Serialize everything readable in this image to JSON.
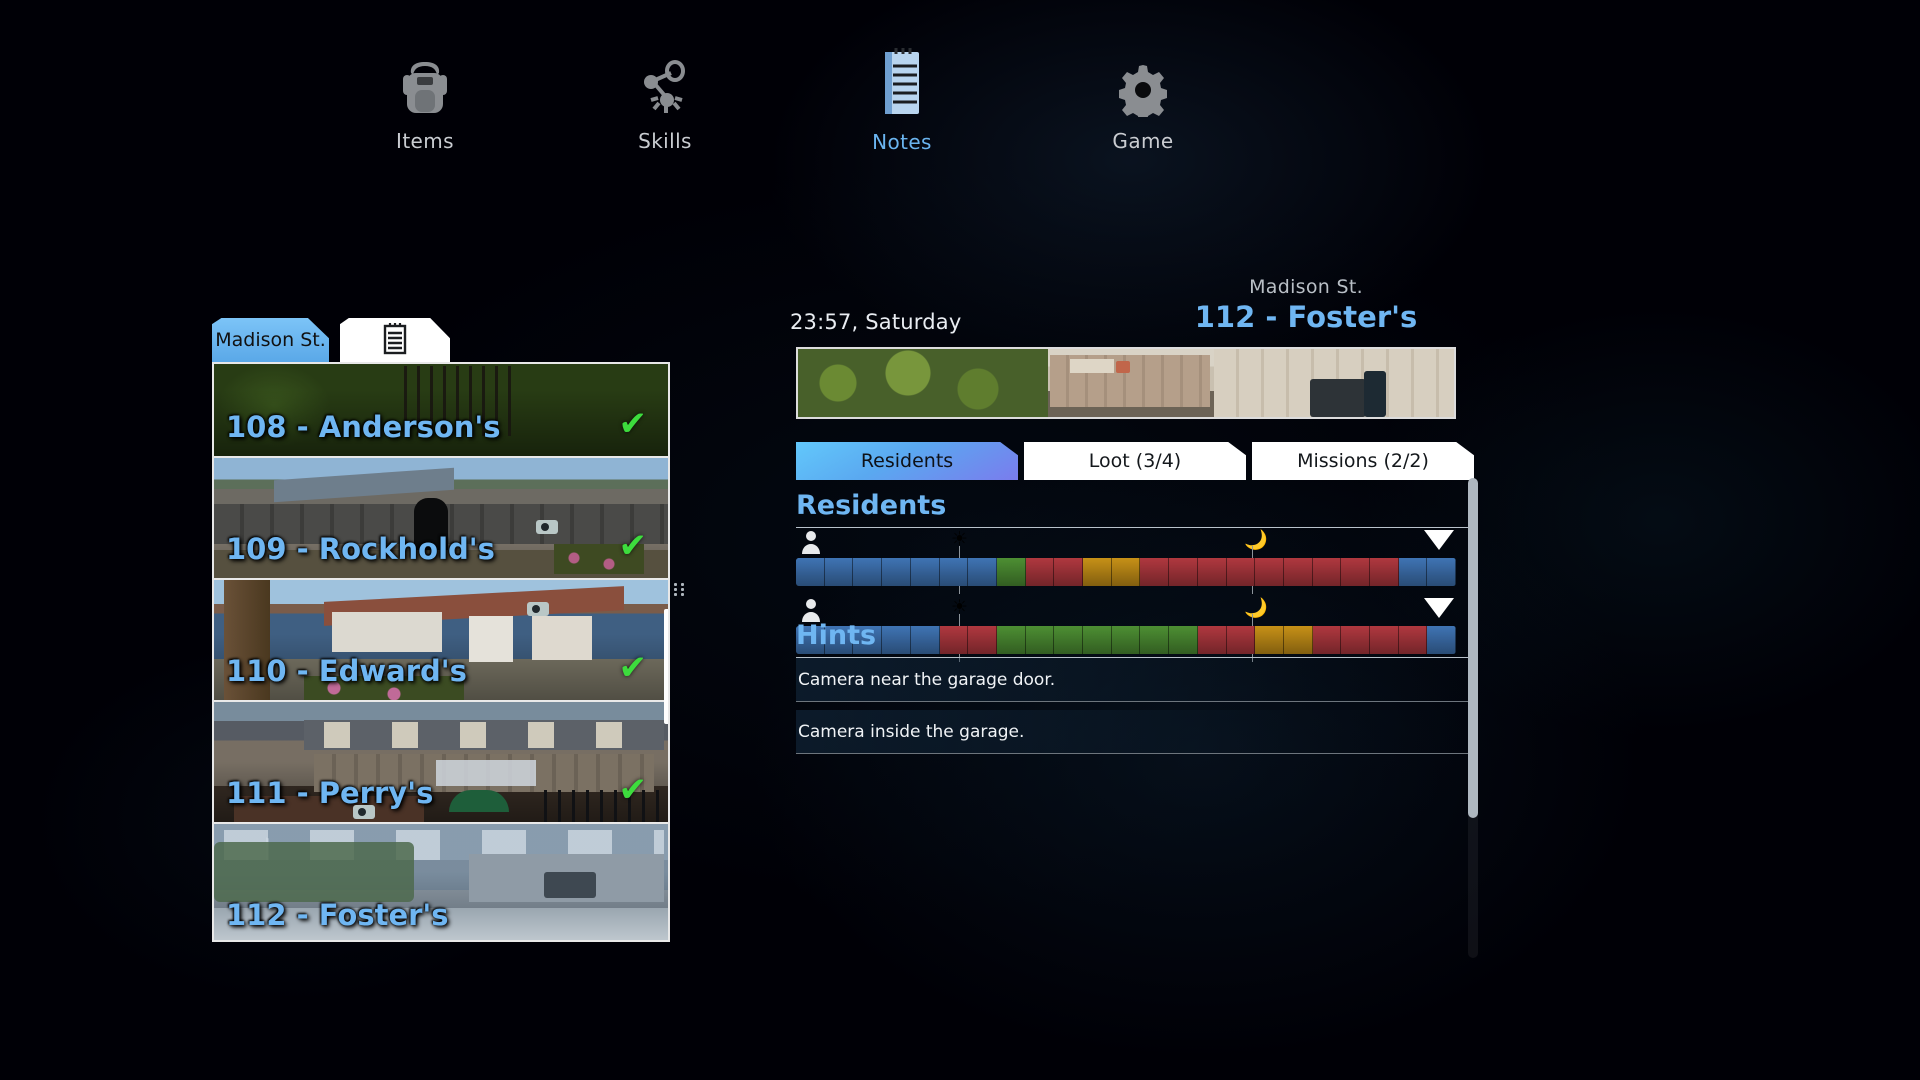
{
  "top_menu": {
    "items": [
      {
        "label": "Items",
        "icon": "backpack-icon",
        "active": false
      },
      {
        "label": "Skills",
        "icon": "skill-tree-icon",
        "active": false
      },
      {
        "label": "Notes",
        "icon": "notepad-icon",
        "active": true
      },
      {
        "label": "Game",
        "icon": "gear-icon",
        "active": false
      }
    ]
  },
  "left_panel": {
    "tabs": [
      {
        "label": "Madison St.",
        "name": "tab-madison-st",
        "active": true
      },
      {
        "label": "",
        "name": "tab-notes-doc",
        "icon": "notepad-icon",
        "active": false
      }
    ],
    "houses": [
      {
        "label": "108 - Anderson's",
        "visited": true,
        "has_camera": false
      },
      {
        "label": "109 - Rockhold's",
        "visited": true,
        "has_camera": true
      },
      {
        "label": "110 - Edward's",
        "visited": true,
        "has_camera": true
      },
      {
        "label": "111 - Perry's",
        "visited": true,
        "has_camera": true
      },
      {
        "label": "112 - Foster's",
        "visited": false,
        "has_camera": false
      },
      {
        "label": "",
        "visited": false,
        "has_camera": false
      }
    ]
  },
  "right_panel": {
    "clock": "23:57, Saturday",
    "street": "Madison St.",
    "house": "112 - Foster's",
    "tabs": [
      {
        "label": "Residents",
        "active": true
      },
      {
        "label": "Loot (3/4)",
        "active": false
      },
      {
        "label": "Missions (2/2)",
        "active": false
      }
    ],
    "residents_heading": "Residents",
    "hints_heading": "Hints",
    "hints": [
      "Camera near the garage door.",
      "Camera inside the garage."
    ],
    "colors": {
      "away": "#3f74b4",
      "asleep": "#4d8f33",
      "home": "#b0383f",
      "busy": "#c79117",
      "accent": "#6fb6f2",
      "tab_active_start": "#62c8fb",
      "tab_active_end": "#7a7ced"
    },
    "sun_icon": "sun-icon",
    "moon_icon": "moon-icon",
    "residents": [
      {
        "name": "resident-1",
        "avatar": "person-icon",
        "schedule": [
          "away",
          "away",
          "away",
          "away",
          "away",
          "away",
          "away",
          "asleep",
          "home",
          "home",
          "busy",
          "busy",
          "home",
          "home",
          "home",
          "home",
          "home",
          "home",
          "home",
          "home",
          "home",
          "away",
          "away"
        ]
      },
      {
        "name": "resident-2",
        "avatar": "person-icon",
        "schedule": [
          "away",
          "away",
          "away",
          "away",
          "away",
          "home",
          "home",
          "asleep",
          "asleep",
          "asleep",
          "asleep",
          "asleep",
          "asleep",
          "asleep",
          "home",
          "home",
          "busy",
          "busy",
          "home",
          "home",
          "home",
          "home",
          "away"
        ]
      }
    ]
  }
}
